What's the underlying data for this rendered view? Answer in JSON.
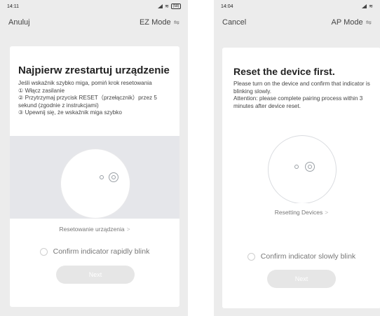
{
  "left": {
    "status": {
      "time": "14:11",
      "battery": "(58)"
    },
    "cancel_label": "Anuluj",
    "mode_label": "EZ Mode",
    "title": "Najpierw zrestartuj urządzenie",
    "instructions": [
      "Jeśli wskaźnik szybko miga, pomiń krok resetowania",
      "① Włącz zasilanie",
      "② Przytrzymaj przycisk RESET（przełącznik）przez 5 sekund (zgodnie z instrukcjami)",
      "③ Upewnij się, że wskaźnik miga szybko"
    ],
    "reset_link": "Resetowanie urządzenia",
    "confirm_label": "Confirm indicator rapidly blink",
    "next_label": "Next"
  },
  "right": {
    "status": {
      "time": "14:04"
    },
    "cancel_label": "Cancel",
    "mode_label": "AP Mode",
    "title": "Reset the device first.",
    "instructions": [
      "Please turn on the device and confirm that indicator is blinking slowly.",
      "Attention: please complete pairing process within 3 minutes after device reset."
    ],
    "reset_link": "Resetting Devices",
    "confirm_label": "Confirm indicator slowly blink",
    "next_label": "Next"
  },
  "icons": {
    "swap": "swap-arrows-icon",
    "chevron": "chevron-right-icon",
    "power": "power-icon"
  },
  "colors": {
    "background": "#ececec",
    "card": "#ffffff",
    "button_disabled": "#e6e6e6",
    "illustration_bg": "#e5e6ea"
  }
}
